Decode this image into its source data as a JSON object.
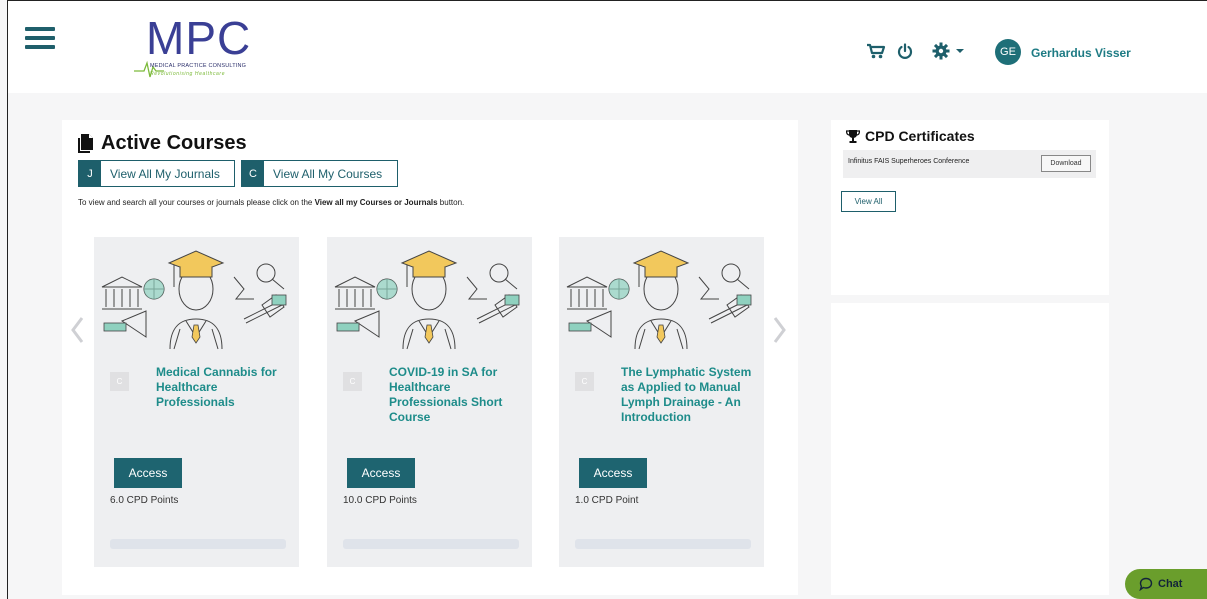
{
  "header": {
    "logo_text": "MPC",
    "logo_line1": "MEDICAL PRACTICE CONSULTING",
    "logo_line2": "Revolutionising Healthcare",
    "user_initials": "GE",
    "user_name": "Gerhardus Visser",
    "icons": [
      "menu-icon",
      "cart-icon",
      "power-icon",
      "gear-icon",
      "caret-down-icon"
    ]
  },
  "active_courses": {
    "title": "Active Courses",
    "journals_button": {
      "lead": "J",
      "label": "View All My Journals"
    },
    "courses_button": {
      "lead": "C",
      "label": "View All My Courses"
    },
    "hint_prefix": "To view and search all your courses or journals please click on the ",
    "hint_bold": "View all my Courses or Journals",
    "hint_suffix": " button.",
    "courses": [
      {
        "badge": "C",
        "title": "Medical Cannabis for Healthcare Professionals",
        "button": "Access",
        "points": "6.0 CPD Points"
      },
      {
        "badge": "C",
        "title": "COVID-19 in SA for Healthcare Professionals Short Course",
        "button": "Access",
        "points": "10.0 CPD Points"
      },
      {
        "badge": "C",
        "title": "The Lymphatic System as Applied to Manual Lymph Drainage - An Introduction",
        "button": "Access",
        "points": "1.0 CPD Point"
      }
    ]
  },
  "cpd": {
    "title": "CPD Certificates",
    "certificates": [
      {
        "name": "Infinitus FAIS Superheroes Conference",
        "button": "Download"
      }
    ],
    "view_all": "View All"
  },
  "chat": {
    "label": "Chat"
  },
  "colors": {
    "primary": "#1e5f6b",
    "link": "#1e8c8a",
    "chat": "#6a9e2c",
    "logo": "#3a3f95"
  }
}
